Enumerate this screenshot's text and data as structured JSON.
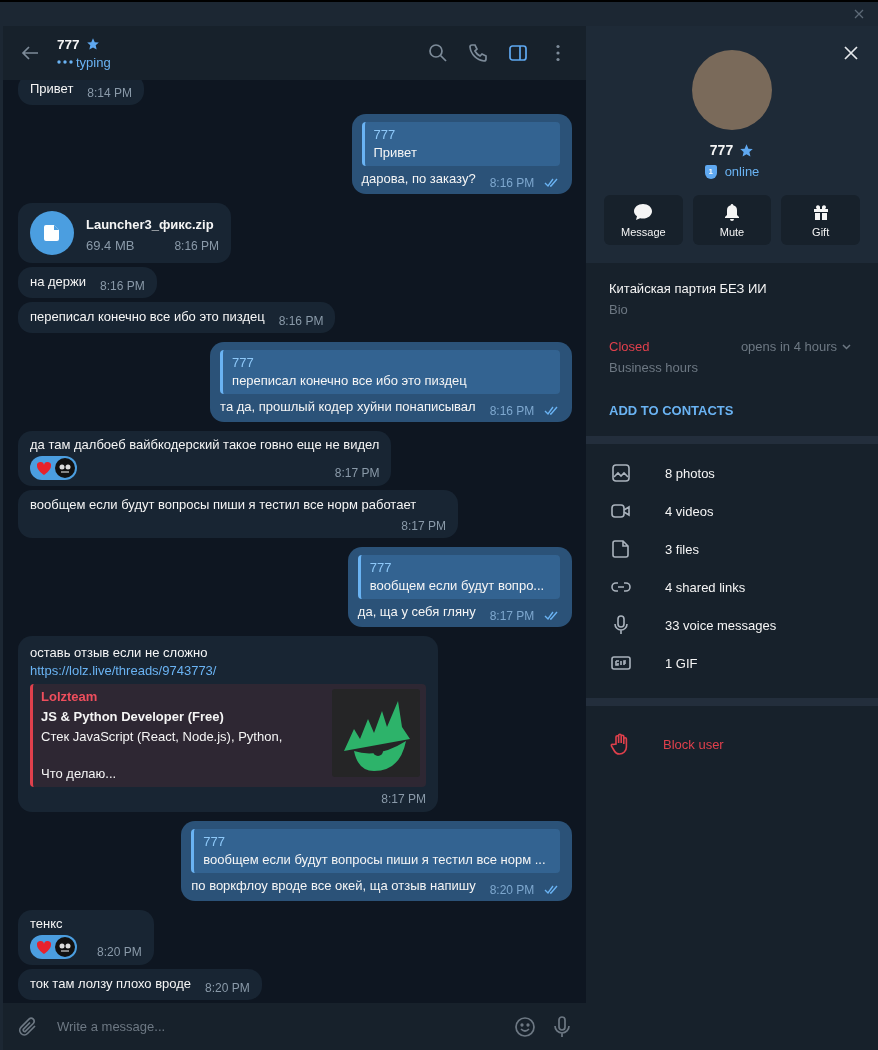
{
  "header": {
    "title": "777",
    "status": "typing",
    "icons": [
      {
        "kind": "search",
        "selected": false
      },
      {
        "kind": "call",
        "selected": false
      },
      {
        "kind": "panel",
        "selected": true
      },
      {
        "kind": "more",
        "selected": false
      }
    ]
  },
  "messages": [
    {
      "kind": "text",
      "outgoing": false,
      "text": "Привет",
      "time": "8:14 PM"
    },
    {
      "kind": "text",
      "outgoing": true,
      "reply": {
        "name": "777",
        "text": "Привет"
      },
      "text": "дарова, по заказу?",
      "time": "8:16 PM",
      "read": true
    },
    {
      "kind": "file",
      "outgoing": false,
      "file_name": "Launcher3_фикс.zip",
      "file_size": "69.4 MB",
      "time": "8:16 PM"
    },
    {
      "kind": "text",
      "outgoing": false,
      "text": "на держи",
      "time": "8:16 PM"
    },
    {
      "kind": "text",
      "outgoing": false,
      "text": "переписал конечно все ибо это пиздец",
      "time": "8:16 PM"
    },
    {
      "kind": "text",
      "outgoing": true,
      "reply": {
        "name": "777",
        "text": "переписал конечно все ибо это пиздец"
      },
      "text": "та да, прошлый кодер хуйни понаписывал",
      "time": "8:16 PM",
      "read": true
    },
    {
      "kind": "text",
      "outgoing": false,
      "text": "да там далбоеб вайбкодерский такое говно еще не видел",
      "reactions": [
        {
          "kind": "heart"
        },
        {
          "kind": "avatar"
        }
      ],
      "time": "8:17 PM"
    },
    {
      "kind": "text",
      "outgoing": false,
      "text": "вообщем если будут вопросы пиши я тестил все норм работает",
      "time": "8:17 PM"
    },
    {
      "kind": "text",
      "outgoing": true,
      "reply": {
        "name": "777",
        "text": "вообщем если будут вопро..."
      },
      "text": "да, ща у себя гляну",
      "time": "8:17 PM",
      "read": true
    },
    {
      "kind": "link",
      "outgoing": false,
      "text": "оставь отзыв если не сложно",
      "link": "https://lolz.live/threads/9743773/",
      "preview": {
        "site": "Lolzteam",
        "title": "JS & Python Developer (Free)",
        "description": [
          "Стек JavaScript (React, Node.js), Python,",
          "Что делаю..."
        ]
      },
      "time": "8:17 PM"
    },
    {
      "kind": "text",
      "outgoing": true,
      "reply": {
        "name": "777",
        "text": "вообщем если будут вопросы пиши я тестил все норм ..."
      },
      "text": "по воркфлоу вроде все окей, ща отзыв напишу",
      "time": "8:20 PM",
      "read": true
    },
    {
      "kind": "text",
      "outgoing": false,
      "text": "тенкс",
      "reactions": [
        {
          "kind": "heart"
        },
        {
          "kind": "avatar"
        }
      ],
      "time": "8:20 PM"
    },
    {
      "kind": "text",
      "outgoing": false,
      "text": "ток там лолзу плохо вроде",
      "time": "8:20 PM"
    }
  ],
  "composer": {
    "placeholder": "Write a message..."
  },
  "profile": {
    "name": "777",
    "badge": "1",
    "status": "online",
    "actions": [
      {
        "kind": "message",
        "label": "Message"
      },
      {
        "kind": "mute",
        "label": "Mute"
      },
      {
        "kind": "gift",
        "label": "Gift"
      }
    ],
    "bio": "Китайская партия БЕЗ ИИ",
    "bio_label": "Bio",
    "hours_status": "Closed",
    "hours_note": "opens in 4 hours",
    "hours_label": "Business hours",
    "add_contact": "ADD TO CONTACTS",
    "media": [
      {
        "kind": "photos",
        "label": "8 photos"
      },
      {
        "kind": "videos",
        "label": "4 videos"
      },
      {
        "kind": "files",
        "label": "3 files"
      },
      {
        "kind": "links",
        "label": "4 shared links"
      },
      {
        "kind": "voice",
        "label": "33 voice messages"
      },
      {
        "kind": "gif",
        "label": "1 GIF"
      }
    ],
    "block": "Block user"
  }
}
